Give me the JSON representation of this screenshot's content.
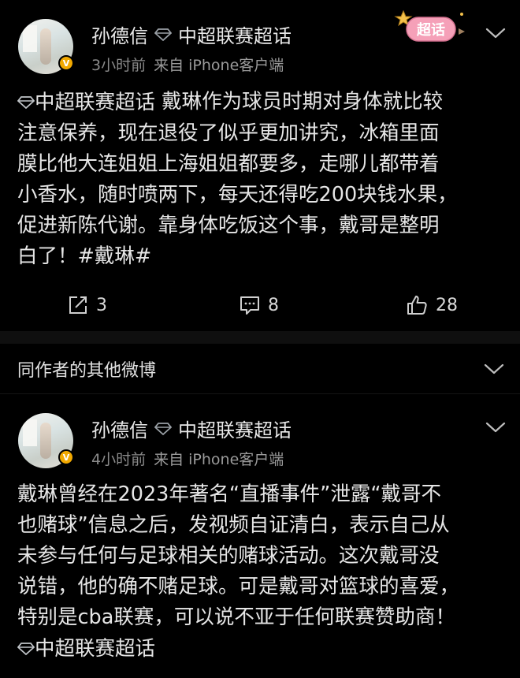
{
  "posts": [
    {
      "username": "孙德信",
      "topic": "中超联赛超话",
      "time": "3小时前",
      "source": "来自 iPhone客户端",
      "sticker_text": "超话",
      "lines": [
        {
          "prefix": "中超联赛超话",
          "text": " 戴琳作为球员时期对身体就比较"
        },
        {
          "text": "注意保养，现在退役了似乎更加讲究，冰箱里面"
        },
        {
          "text": "膜比他大连姐姐上海姐姐都要多，走哪儿都带着"
        },
        {
          "text": "小香水，随时喷两下，每天还得吃200块钱水果，"
        },
        {
          "text": "促进新陈代谢。靠身体吃饭这个事，戴哥是整明"
        },
        {
          "text": "白了！#戴琳#"
        }
      ],
      "actions": {
        "repost": "3",
        "comment": "8",
        "like": "28"
      }
    },
    {
      "username": "孙德信",
      "topic": "中超联赛超话",
      "time": "4小时前",
      "source": "来自 iPhone客户端",
      "lines": [
        {
          "text": "戴琳曾经在2023年著名“直播事件”泄露“戴哥不"
        },
        {
          "text": "也赌球”信息之后，发视频自证清白，表示自己从"
        },
        {
          "text": "未参与任何与足球相关的赌球活动。这次戴哥没"
        },
        {
          "text": "说错，他的确不赌足球。可是戴哥对篮球的喜爱，"
        },
        {
          "text": "特别是cba联赛，可以说不亚于任何联赛赞助商！"
        },
        {
          "prefix": "中超联赛超话",
          "text": ""
        }
      ]
    }
  ],
  "other_posts_title": "同作者的其他微博",
  "colors": {
    "background": "#000000",
    "text": "#e6e6e6",
    "meta": "#8a8a8a",
    "badge": "#f2a900"
  }
}
